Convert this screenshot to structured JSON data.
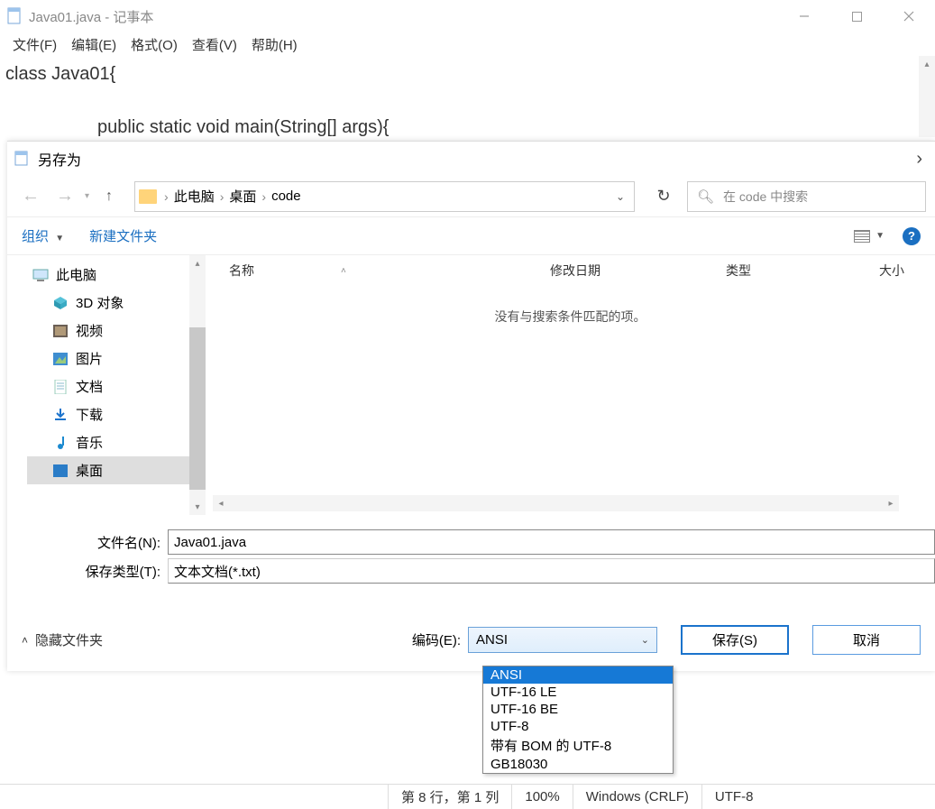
{
  "notepad": {
    "title": "Java01.java - 记事本",
    "menu": {
      "file": "文件(F)",
      "edit": "编辑(E)",
      "format": "格式(O)",
      "view": "查看(V)",
      "help": "帮助(H)"
    },
    "body": {
      "line1": "class Java01{",
      "line2": "public static void main(String[] args){"
    },
    "status": {
      "pos": "第 8 行，第 1 列",
      "zoom": "100%",
      "eol": "Windows (CRLF)",
      "enc": "UTF-8"
    }
  },
  "saveas": {
    "title": "另存为",
    "breadcrumb": {
      "a": "此电脑",
      "b": "桌面",
      "c": "code"
    },
    "search_placeholder": "在 code 中搜索",
    "toolbar": {
      "organize": "组织",
      "newfolder": "新建文件夹"
    },
    "columns": {
      "name": "名称",
      "date": "修改日期",
      "type": "类型",
      "size": "大小"
    },
    "empty": "没有与搜索条件匹配的项。",
    "tree": {
      "root": "此电脑",
      "items": [
        "3D 对象",
        "视频",
        "图片",
        "文档",
        "下载",
        "音乐",
        "桌面"
      ]
    },
    "labels": {
      "filename": "文件名(N):",
      "savetype": "保存类型(T):",
      "encoding": "编码(E):",
      "hide": "隐藏文件夹"
    },
    "filename": "Java01.java",
    "savetype": "文本文档(*.txt)",
    "encoding_selected": "ANSI",
    "encoding_options": [
      "ANSI",
      "UTF-16 LE",
      "UTF-16 BE",
      "UTF-8",
      "带有 BOM 的 UTF-8",
      "GB18030"
    ],
    "buttons": {
      "save": "保存(S)",
      "cancel": "取消"
    }
  }
}
